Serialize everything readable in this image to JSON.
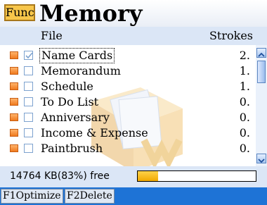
{
  "titlebar": {
    "func_label": "Func",
    "title": "Memory"
  },
  "header": {
    "file_label": "File",
    "strokes_label": "Strokes"
  },
  "list": {
    "items": [
      {
        "name": "Name Cards",
        "count": "2.",
        "checked": true,
        "selected": true
      },
      {
        "name": "Memorandum",
        "count": "1.",
        "checked": false,
        "selected": false
      },
      {
        "name": "Schedule",
        "count": "1.",
        "checked": false,
        "selected": false
      },
      {
        "name": "To Do List",
        "count": "0.",
        "checked": false,
        "selected": false
      },
      {
        "name": "Anniversary",
        "count": "0.",
        "checked": false,
        "selected": false
      },
      {
        "name": "Income & Expense",
        "count": "0.",
        "checked": false,
        "selected": false
      },
      {
        "name": "Paintbrush",
        "count": "0.",
        "checked": false,
        "selected": false
      }
    ]
  },
  "status": {
    "text": "14764 KB(83%) free",
    "used_fraction": 0.17
  },
  "fkeys": {
    "f1": "F1Optimize",
    "f2": "F2Delete"
  },
  "colors": {
    "accent": "#1e73d6",
    "header_bg": "#dbe6f6",
    "progress": "#f0a800",
    "func_btn": "#f7c64a"
  }
}
